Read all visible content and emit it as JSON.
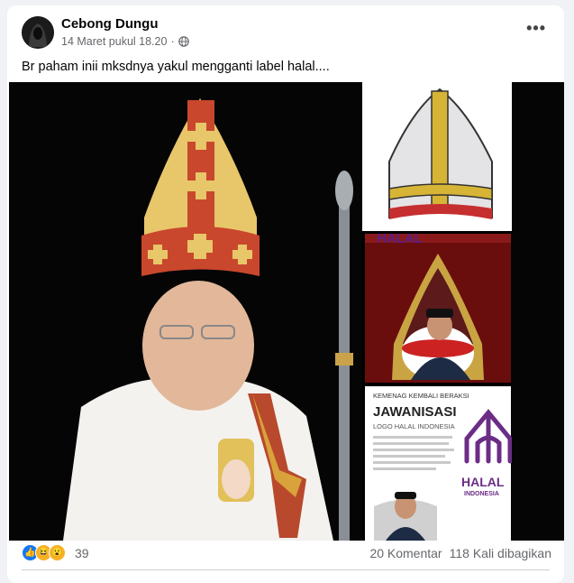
{
  "post": {
    "author": "Cebong Dungu",
    "date": "14 Maret pukul 18.20",
    "privacy_icon": "globe-icon",
    "caption": "Br paham inii mksdnya yakul mengganti label halal...."
  },
  "images": {
    "halal_banner_text": "HALAL",
    "kemenag_line": "KEMENAG KEMBALI BERAKSI",
    "jawanisasi": "JAWANISASI",
    "logo_line": "LOGO HALAL INDONESIA",
    "halal_word": "HALAL",
    "indonesia_word": "INDONESIA"
  },
  "reactions": {
    "count": "39",
    "types": [
      "like-icon",
      "haha-icon",
      "wow-icon"
    ]
  },
  "stats": {
    "comments": "20 Komentar",
    "shares": "118 Kali dibagikan"
  },
  "colors": {
    "like": "#1877f2",
    "reaction_yellow": "#f7b125",
    "halal_purple": "#6b2d86"
  }
}
